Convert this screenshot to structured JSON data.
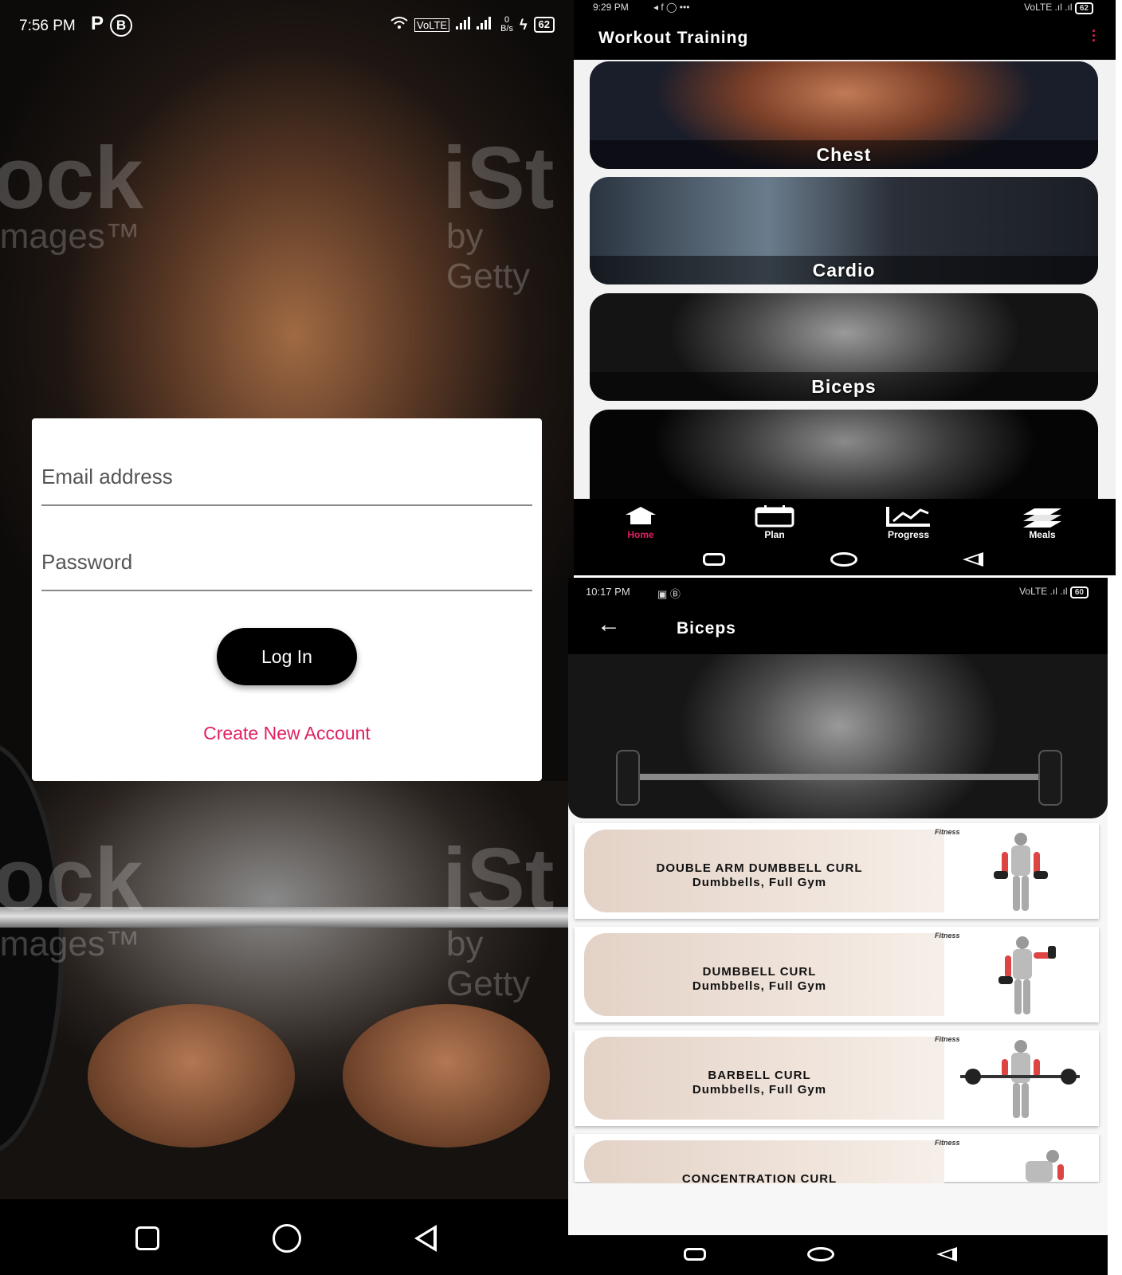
{
  "login": {
    "status": {
      "time": "7:56 PM",
      "badge_p": "P",
      "badge_b": "B",
      "net": "VoLTE",
      "speed_val": "0",
      "speed_unit": "B/s",
      "battery": "62"
    },
    "watermark": {
      "a": "ock",
      "b": "images™",
      "c": "iSt",
      "d": "by Getty"
    },
    "email_label": "Email address",
    "password_label": "Password",
    "login_button": "Log In",
    "create_account": "Create New Account"
  },
  "workout": {
    "status": {
      "time": "9:29 PM",
      "icons": "◂ f ◯ •••",
      "right": "VoLTE .ıl .ıl",
      "battery": "62"
    },
    "title": "Workout Training",
    "categories": [
      {
        "label": "Chest"
      },
      {
        "label": "Cardio"
      },
      {
        "label": "Biceps"
      },
      {
        "label": ""
      }
    ],
    "tabs": [
      {
        "label": "Home",
        "icon": "home-icon"
      },
      {
        "label": "Plan",
        "icon": "calendar-icon"
      },
      {
        "label": "Progress",
        "icon": "chart-icon"
      },
      {
        "label": "Meals",
        "icon": "meals-icon"
      }
    ]
  },
  "biceps": {
    "status": {
      "time": "10:17 PM",
      "right": "VoLTE .ıl .ıl",
      "battery": "60"
    },
    "title": "Biceps",
    "exercises": [
      {
        "name": "DOUBLE ARM DUMBBELL CURL",
        "equipment": "Dumbbells, Full Gym"
      },
      {
        "name": "DUMBBELL CURL",
        "equipment": "Dumbbells, Full Gym"
      },
      {
        "name": "BARBELL CURL",
        "equipment": "Dumbbells, Full Gym"
      },
      {
        "name": "CONCENTRATION CURL",
        "equipment": ""
      }
    ],
    "brand": "Fitness"
  },
  "colors": {
    "accent": "#e11f63",
    "dark": "#000000",
    "card_tint": "#e3d2c6"
  }
}
